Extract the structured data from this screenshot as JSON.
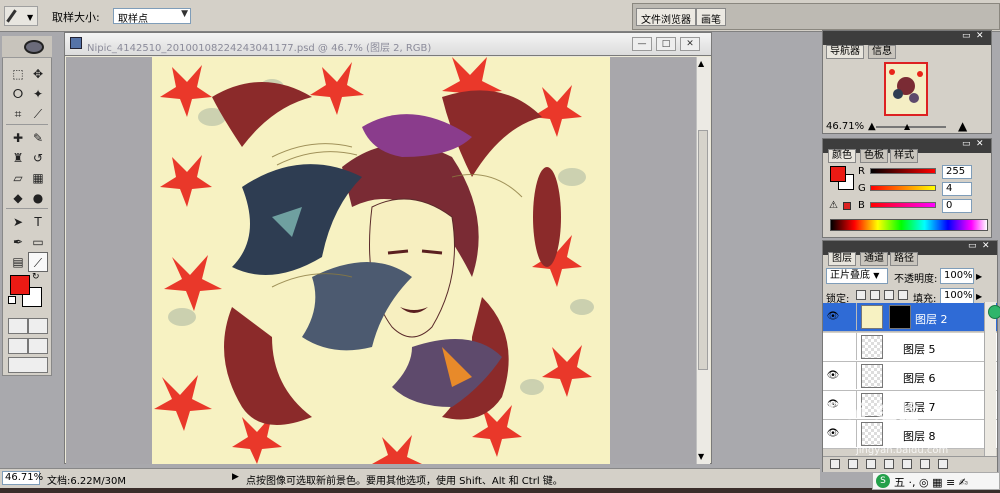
{
  "options_bar": {
    "sample_size_label": "取样大小:",
    "sample_size_value": "取样点",
    "well_tabs": [
      "文件浏览器",
      "画笔"
    ]
  },
  "document": {
    "title": "Nipic_4142510_20100108224243041177.psd @ 46.7% (图层 2, RGB)",
    "window_buttons": {
      "min": "—",
      "max": "□",
      "close": "✕"
    }
  },
  "status_bar": {
    "zoom": "46.71%",
    "doc_info": "文档:6.22M/30M",
    "hint": "点按图像可选取新前景色。要用其他选项，使用 Shift、Alt 和 Ctrl 键。"
  },
  "navigator_panel": {
    "tabs": [
      "导航器",
      "信息"
    ],
    "zoom": "46.71%"
  },
  "color_panel": {
    "tabs": [
      "颜色",
      "色板",
      "样式"
    ],
    "channels": [
      {
        "label": "R",
        "value": "255",
        "gradient": "linear-gradient(90deg,#000,#f00)"
      },
      {
        "label": "G",
        "value": "4",
        "gradient": "linear-gradient(90deg,#f00,#ff0)"
      },
      {
        "label": "B",
        "value": "0",
        "gradient": "linear-gradient(90deg,#f00,#f0f)"
      }
    ],
    "foreground": "#ea1a14",
    "background": "#ffffff"
  },
  "layers_panel": {
    "tabs": [
      "图层",
      "通道",
      "路径"
    ],
    "blend_mode": "正片叠底",
    "opacity_label": "不透明度:",
    "opacity": "100%",
    "lock_label": "锁定:",
    "fill_label": "填充:",
    "fill": "100%",
    "layers": [
      {
        "name": "图层 2",
        "visible": true,
        "selected": true
      },
      {
        "name": "图层 5",
        "visible": false,
        "selected": false
      },
      {
        "name": "图层 6",
        "visible": true,
        "selected": false
      },
      {
        "name": "图层 7",
        "visible": true,
        "selected": false
      },
      {
        "name": "图层 8",
        "visible": true,
        "selected": false
      }
    ]
  },
  "watermark": {
    "text": "Bai 经验",
    "sub": "jingyan.baidu.com"
  },
  "ime": {
    "text": "五 ·, ◎ ▦ ≡ ✍"
  },
  "colors": {
    "foreground": "#ea1a14",
    "canvas": "#f7f2c2",
    "selection": "#2f6bd6"
  }
}
